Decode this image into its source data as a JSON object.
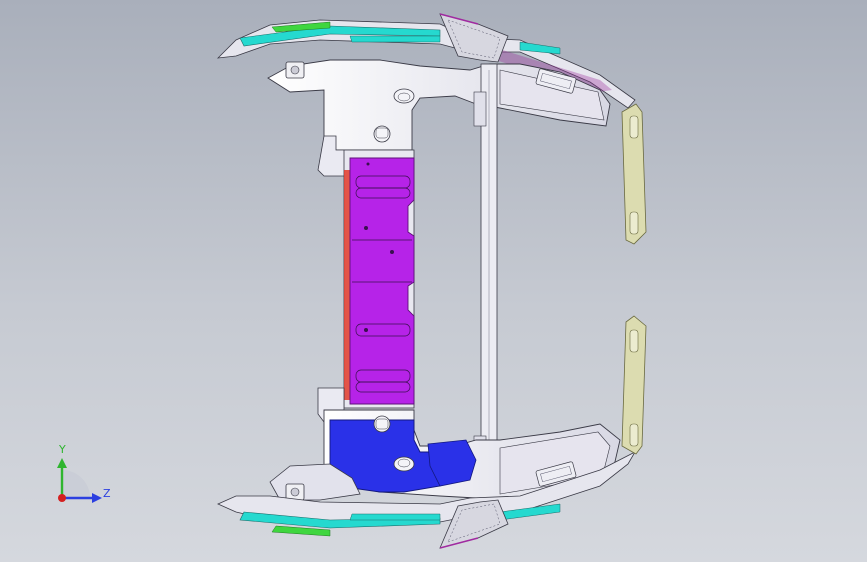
{
  "app": {
    "type": "cad-3d-viewport"
  },
  "view": {
    "background_top": "#a9afbb",
    "background_bottom": "#d5d8de"
  },
  "model": {
    "part_colors": {
      "frame": "#f0f0f6",
      "frame_edge": "#3a3a46",
      "center_panel": "#b623e8",
      "lower_panel": "#2a31e8",
      "hinge_plate": "#dcdcb0",
      "trim_cyan": "#25d9cf",
      "trim_green": "#3fd63f",
      "accent_red": "#e23a2a"
    }
  },
  "triad": {
    "y_label": "Y",
    "z_label": "Z",
    "y_color": "#2fb52f",
    "z_color": "#2b3fe0",
    "x_color": "#d42020",
    "icon": "coordinate-triad-icon"
  }
}
